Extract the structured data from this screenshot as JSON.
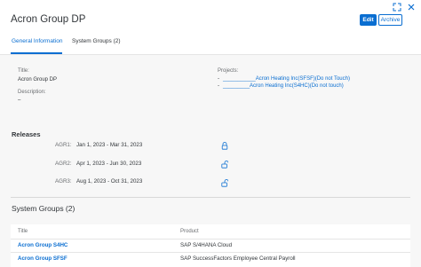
{
  "header": {
    "title": "Acron Group DP",
    "edit_label": "Edit",
    "archive_label": "Archive",
    "tabs": [
      "General Information",
      "System Groups (2)"
    ]
  },
  "general": {
    "title_label": "Title:",
    "title_value": "Acron Group DP",
    "description_label": "Description:",
    "description_value": "–",
    "projects_label": "Projects:",
    "projects": [
      "___________Acron Heating Inc(SFSF)(Do not Touch)",
      "_________Acron Heating Inc(S4HC)(Do not touch)"
    ]
  },
  "releases": {
    "title": "Releases",
    "items": [
      {
        "label": "AGR1:",
        "range": "Jan 1, 2023 - Mar 31, 2023",
        "icon": "locked-icon"
      },
      {
        "label": "AGR2:",
        "range": "Apr 1, 2023 - Jun 30, 2023",
        "icon": "unlocked-icon"
      },
      {
        "label": "AGR3:",
        "range": "Aug 1, 2023 - Oct 31, 2023",
        "icon": "unlocked-icon"
      }
    ]
  },
  "system_groups": {
    "title": "System Groups (2)",
    "columns": [
      "Title",
      "Product"
    ],
    "rows": [
      {
        "title": "Acron Group S4HC",
        "product": "SAP S/4HANA Cloud"
      },
      {
        "title": "Acron Group SFSF",
        "product": "SAP SuccessFactors Employee Central Payroll"
      }
    ]
  },
  "colors": {
    "accent": "#0a6ed1",
    "background": "#f7f7f7"
  }
}
